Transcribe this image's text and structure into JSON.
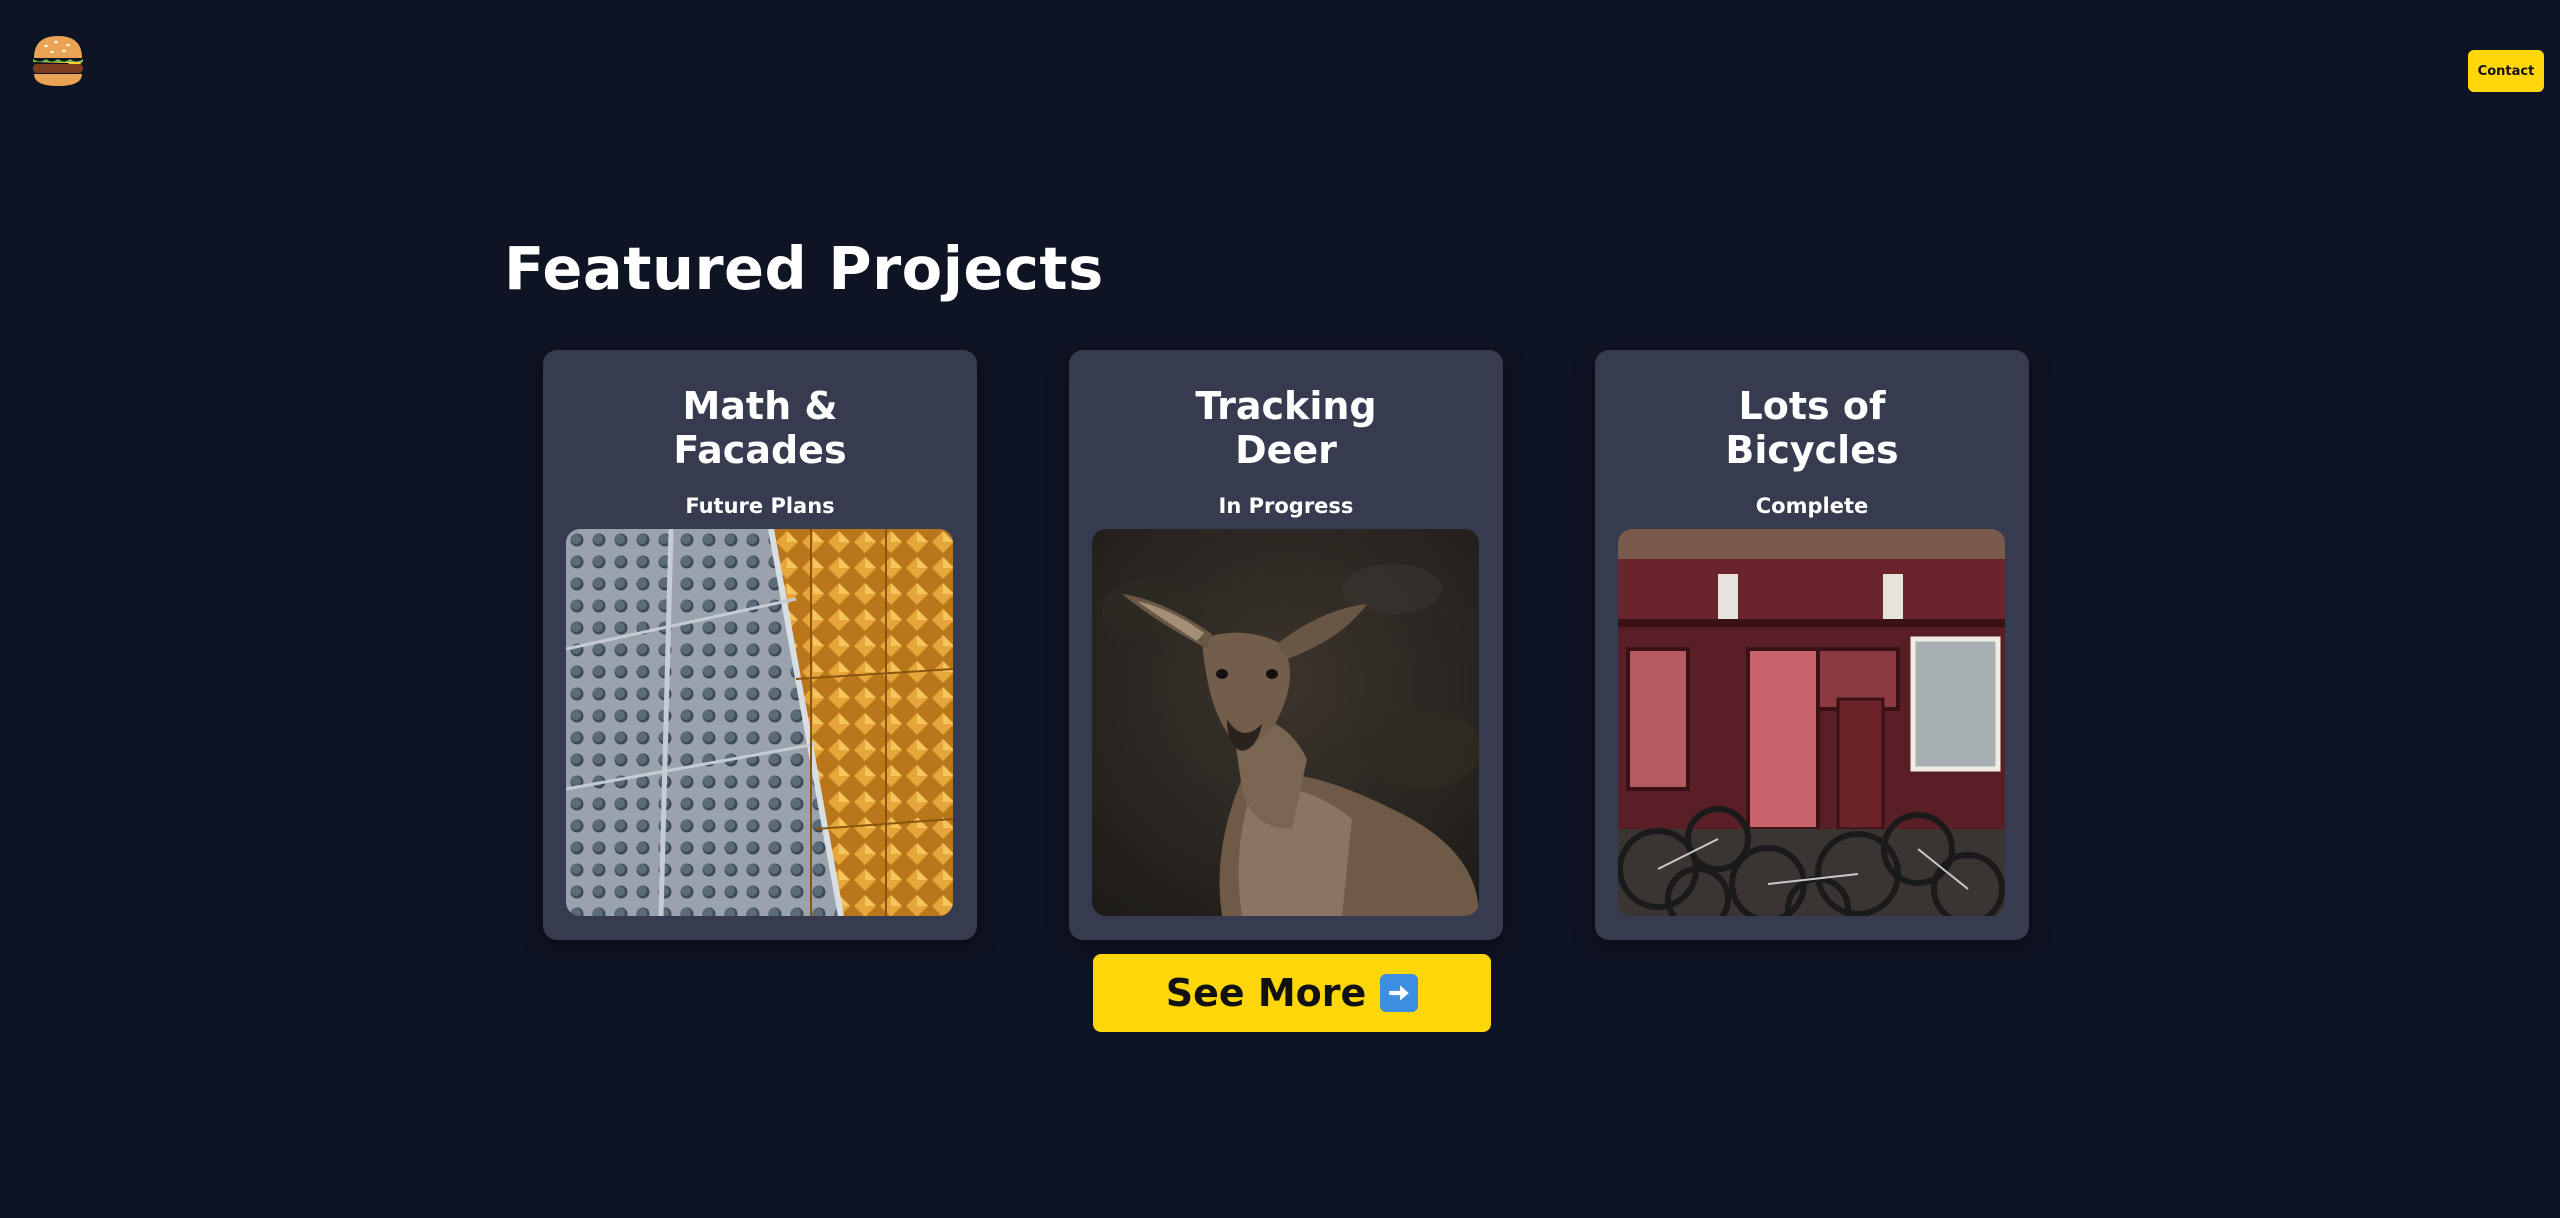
{
  "header": {
    "logo_icon": "hamburger-emoji-icon",
    "contact_label": "Contact",
    "accent_color": "#ffd60a"
  },
  "main": {
    "title": "Featured Projects",
    "projects": [
      {
        "title": "Math & Facades",
        "status": "Future Plans",
        "image_icon": "facade-photo"
      },
      {
        "title": "Tracking Deer",
        "status": "In Progress",
        "image_icon": "deer-photo"
      },
      {
        "title": "Lots of Bicycles",
        "status": "Complete",
        "image_icon": "bicycles-photo"
      }
    ],
    "see_more_label": "See More",
    "see_more_icon": "right-arrow-icon"
  },
  "colors": {
    "background": "#0f1424",
    "card": "#363b50",
    "accent": "#ffd60a"
  }
}
